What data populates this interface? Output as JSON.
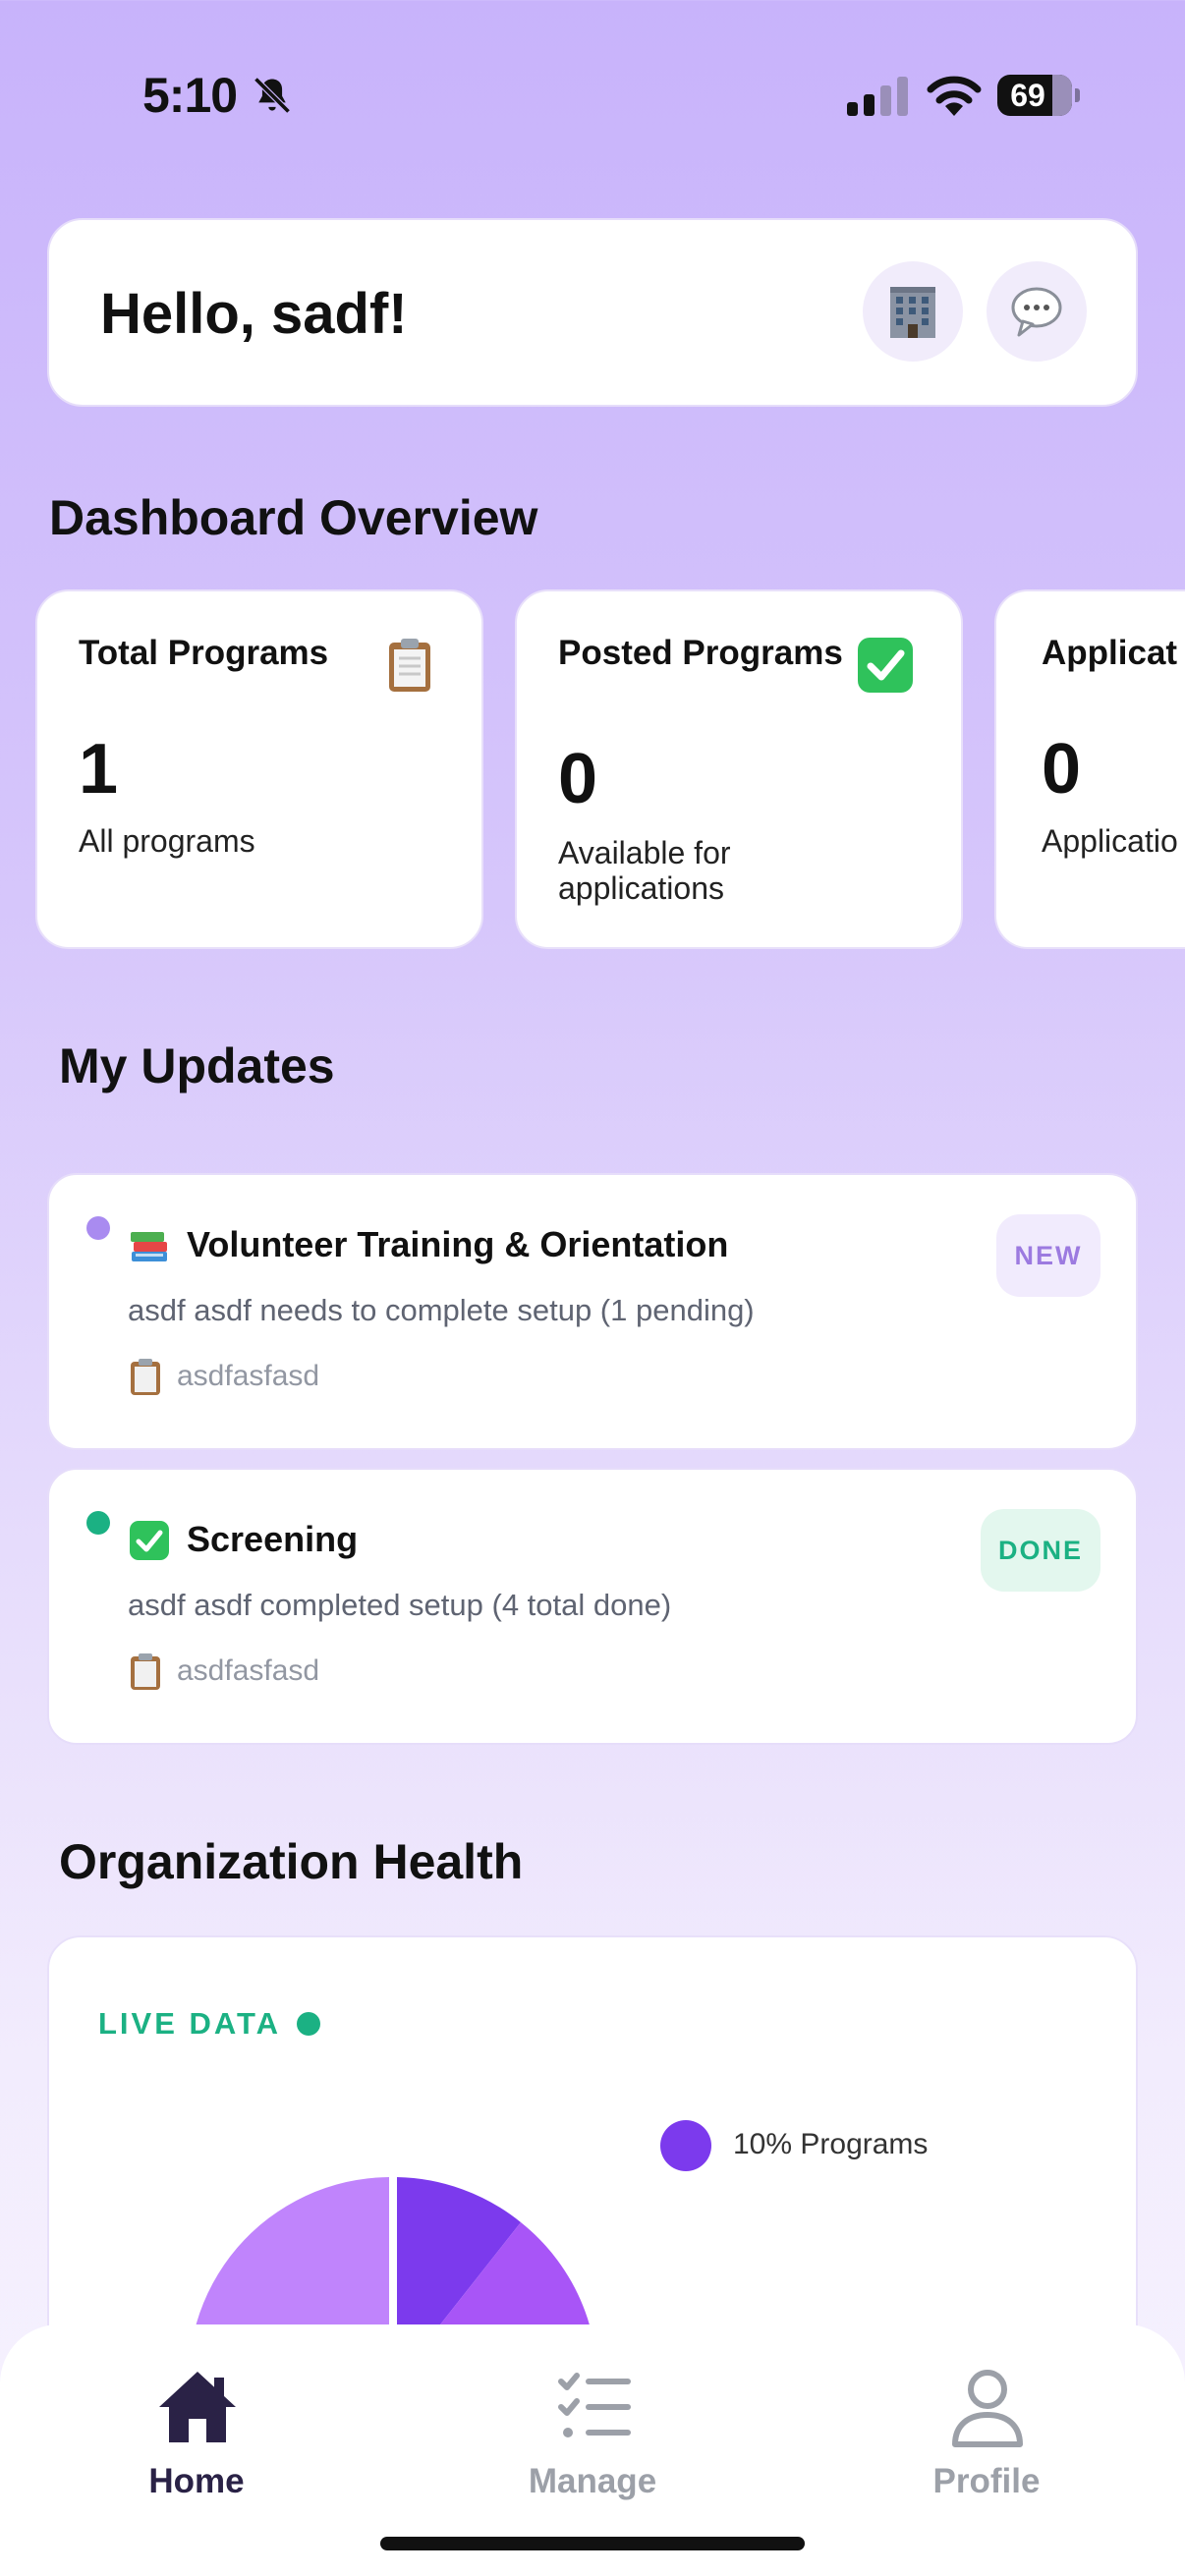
{
  "status_bar": {
    "time": "5:10",
    "battery": "69"
  },
  "header": {
    "greeting": "Hello, sadf!"
  },
  "overview": {
    "title": "Dashboard Overview",
    "cards": [
      {
        "title": "Total Programs",
        "value": "1",
        "subtitle": "All programs",
        "icon": "clipboard-icon"
      },
      {
        "title": "Posted Programs",
        "value": "0",
        "subtitle": "Available for applications",
        "icon": "check-mark-icon"
      },
      {
        "title": "Applicat",
        "value": "0",
        "subtitle": "Applicatio",
        "icon": ""
      }
    ]
  },
  "updates": {
    "title": "My Updates",
    "items": [
      {
        "title": "Volunteer Training & Orientation",
        "description": "asdf asdf needs to complete setup (1 pending)",
        "meta": "asdfasfasd",
        "badge": "NEW",
        "dot_color": "#a98bf0",
        "icon": "books-icon"
      },
      {
        "title": "Screening",
        "description": "asdf asdf completed setup (4 total done)",
        "meta": "asdfasfasd",
        "badge": "DONE",
        "dot_color": "#1bb183",
        "icon": "check-mark-icon"
      }
    ]
  },
  "health": {
    "title": "Organization Health",
    "live_label": "LIVE DATA",
    "legend": [
      {
        "label": "10% Programs",
        "color": "#7c3aed"
      }
    ]
  },
  "nav": {
    "items": [
      {
        "label": "Home",
        "active": true
      },
      {
        "label": "Manage",
        "active": false
      },
      {
        "label": "Profile",
        "active": false
      }
    ]
  },
  "colors": {
    "accent": "#7c3aed",
    "success": "#1bb183",
    "nav_active": "#2a2246",
    "nav_inactive": "#9ca0a8"
  }
}
